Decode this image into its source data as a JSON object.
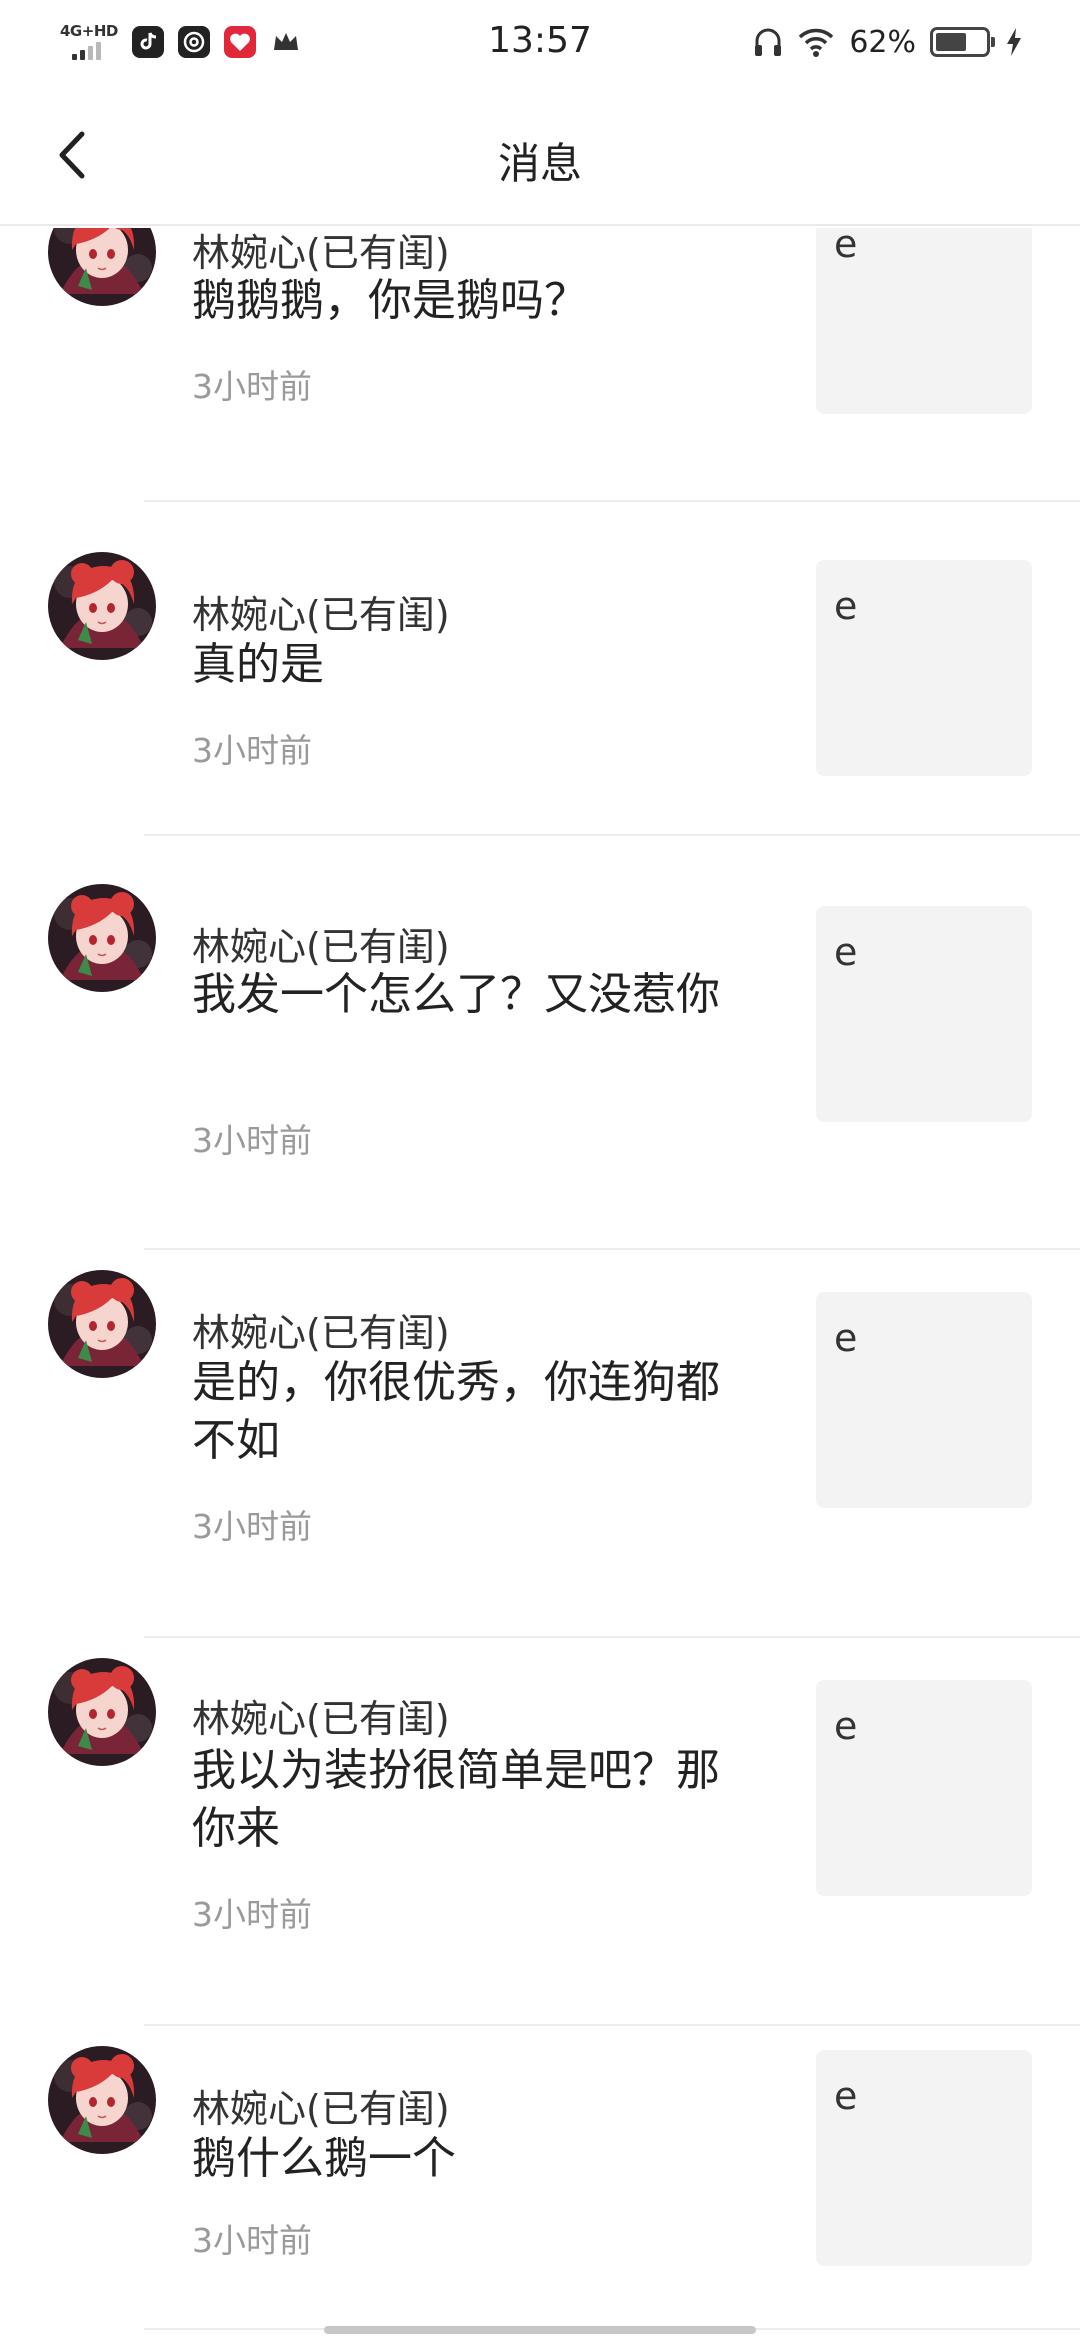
{
  "status_bar": {
    "network": "4G+HD",
    "time": "13:57",
    "battery_percent": "62%",
    "battery_level": 0.62,
    "icons": [
      "signal-icon",
      "tiktok-icon",
      "at-mail-icon",
      "red-heart-app-icon",
      "crown-icon",
      "headphones-icon",
      "wifi-icon",
      "battery-icon",
      "charging-icon"
    ]
  },
  "header": {
    "title": "消息",
    "back_icon": "chevron-left-icon"
  },
  "messages": [
    {
      "name": "林婉心(已有闺)",
      "message": "鹅鹅鹅，你是鹅吗？",
      "time": "3小时前",
      "thumb_text": "e"
    },
    {
      "name": "林婉心(已有闺)",
      "message": "真的是",
      "time": "3小时前",
      "thumb_text": "e"
    },
    {
      "name": "林婉心(已有闺)",
      "message": "我发一个怎么了？又没惹你",
      "time": "3小时前",
      "thumb_text": "e"
    },
    {
      "name": "林婉心(已有闺)",
      "message": "是的，你很优秀，你连狗都不如",
      "time": "3小时前",
      "thumb_text": "e"
    },
    {
      "name": "林婉心(已有闺)",
      "message": "我以为装扮很简单是吧？那你来",
      "time": "3小时前",
      "thumb_text": "e"
    },
    {
      "name": "林婉心(已有闺)",
      "message": "鹅什么鹅一个",
      "time": "3小时前",
      "thumb_text": "e"
    }
  ],
  "colors": {
    "background": "#ffffff",
    "divider": "#ececec",
    "secondary_text": "#9a9a9a",
    "thumb_bg": "#f3f3f3",
    "avatar_hair": "#d93a3a"
  }
}
